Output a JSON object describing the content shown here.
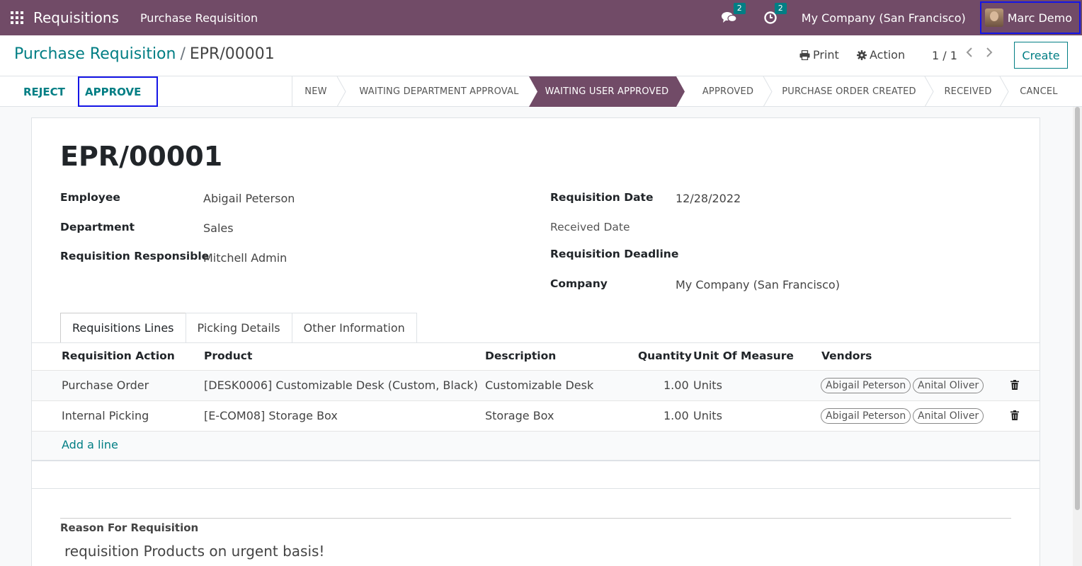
{
  "navbar": {
    "app_name": "Requisitions",
    "menu_item": "Purchase Requisition",
    "messages_count": "2",
    "activities_count": "2",
    "company": "My Company (San Francisco)",
    "user": "Marc Demo"
  },
  "control": {
    "breadcrumb_parent": "Purchase Requisition",
    "breadcrumb_sep": "/",
    "breadcrumb_current": "EPR/00001",
    "print_label": "Print",
    "action_label": "Action",
    "pager": "1 / 1",
    "create_label": "Create"
  },
  "statusbar": {
    "reject_label": "REJECT",
    "approve_label": "APPROVE",
    "stages": [
      "NEW",
      "WAITING DEPARTMENT APPROVAL",
      "WAITING USER APPROVED",
      "APPROVED",
      "PURCHASE ORDER CREATED",
      "RECEIVED",
      "CANCEL"
    ],
    "active_stage": "WAITING USER APPROVED"
  },
  "record": {
    "title": "EPR/00001",
    "employee_label": "Employee",
    "employee": "Abigail Peterson",
    "department_label": "Department",
    "department": "Sales",
    "responsible_label": "Requisition Responsible",
    "responsible": "Mitchell Admin",
    "req_date_label": "Requisition Date",
    "req_date": "12/28/2022",
    "received_date_label": "Received Date",
    "deadline_label": "Requisition Deadline",
    "company_label": "Company",
    "company": "My Company (San Francisco)"
  },
  "tabs": [
    "Requisitions Lines",
    "Picking Details",
    "Other Information"
  ],
  "lines": {
    "headers": {
      "action": "Requisition Action",
      "product": "Product",
      "description": "Description",
      "quantity": "Quantity",
      "uom": "Unit Of Measure",
      "vendors": "Vendors"
    },
    "rows": [
      {
        "action": "Purchase Order",
        "product": "[DESK0006] Customizable Desk (Custom, Black)",
        "description": "Customizable Desk",
        "quantity": "1.00",
        "uom": "Units",
        "vendors": [
          "Abigail Peterson",
          "Anital Oliver"
        ]
      },
      {
        "action": "Internal Picking",
        "product": "[E-COM08] Storage Box",
        "description": "Storage Box",
        "quantity": "1.00",
        "uom": "Units",
        "vendors": [
          "Abigail Peterson",
          "Anital Oliver"
        ]
      }
    ],
    "add_line": "Add a line"
  },
  "reason": {
    "label": "Reason For Requisition",
    "value": "requisition Products on urgent basis!"
  },
  "colors": {
    "brand": "#714b67",
    "accent": "#017e84",
    "highlight_border": "#1515e6"
  }
}
